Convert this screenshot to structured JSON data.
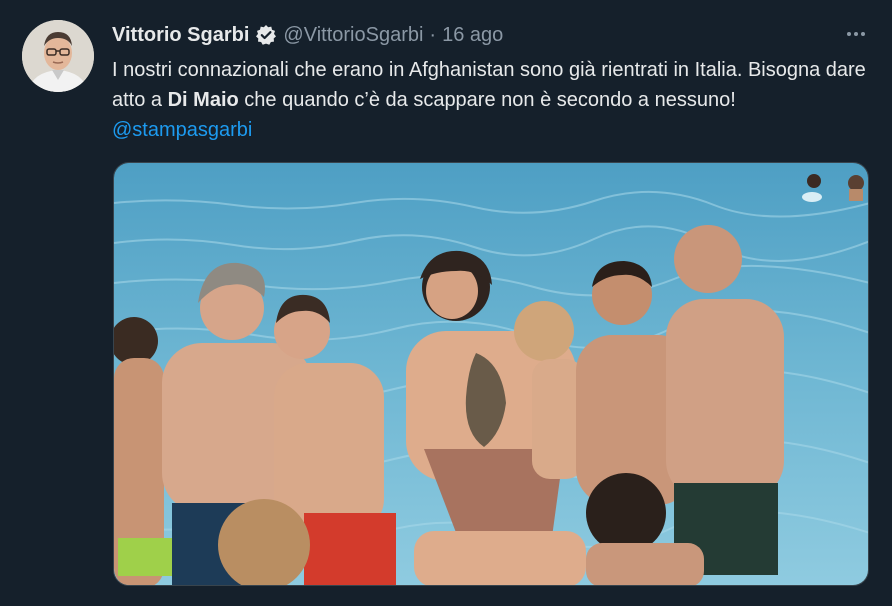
{
  "tweet": {
    "author_name": "Vittorio Sgarbi",
    "handle": "@VittorioSgarbi",
    "separator": "·",
    "time": "16 ago",
    "text_part1": "I nostri connazionali che erano in Afghanistan sono già rientrati in Italia. Bisogna dare atto a ",
    "text_bold": "Di Maio",
    "text_part2": " che quando c’è da scappare non è secondo a nessuno! ",
    "mention": "@stampasgarbi"
  },
  "icons": {
    "verified": "verified-badge-icon",
    "more": "more-horizontal-icon"
  },
  "colors": {
    "background": "#15202b",
    "text": "#e7e9ea",
    "secondary": "#8b98a5",
    "accent": "#1d9bf0"
  }
}
